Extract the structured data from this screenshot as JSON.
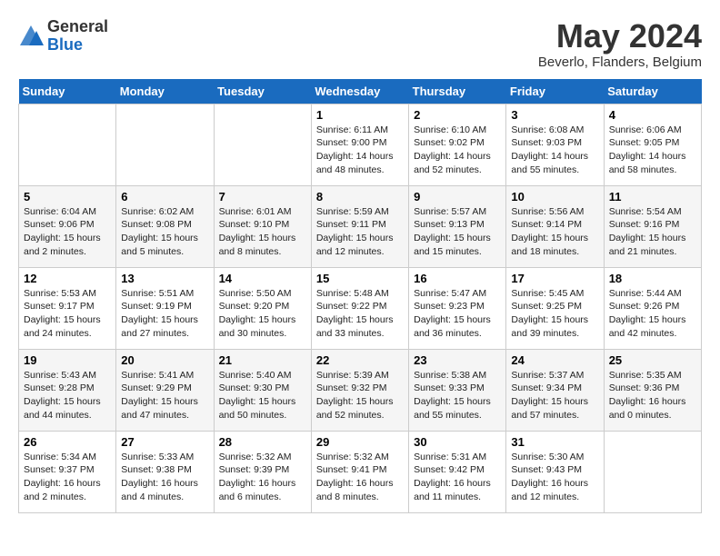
{
  "logo": {
    "general": "General",
    "blue": "Blue"
  },
  "title": "May 2024",
  "subtitle": "Beverlo, Flanders, Belgium",
  "days_of_week": [
    "Sunday",
    "Monday",
    "Tuesday",
    "Wednesday",
    "Thursday",
    "Friday",
    "Saturday"
  ],
  "weeks": [
    [
      {
        "day": "",
        "info": ""
      },
      {
        "day": "",
        "info": ""
      },
      {
        "day": "",
        "info": ""
      },
      {
        "day": "1",
        "info": "Sunrise: 6:11 AM\nSunset: 9:00 PM\nDaylight: 14 hours\nand 48 minutes."
      },
      {
        "day": "2",
        "info": "Sunrise: 6:10 AM\nSunset: 9:02 PM\nDaylight: 14 hours\nand 52 minutes."
      },
      {
        "day": "3",
        "info": "Sunrise: 6:08 AM\nSunset: 9:03 PM\nDaylight: 14 hours\nand 55 minutes."
      },
      {
        "day": "4",
        "info": "Sunrise: 6:06 AM\nSunset: 9:05 PM\nDaylight: 14 hours\nand 58 minutes."
      }
    ],
    [
      {
        "day": "5",
        "info": "Sunrise: 6:04 AM\nSunset: 9:06 PM\nDaylight: 15 hours\nand 2 minutes."
      },
      {
        "day": "6",
        "info": "Sunrise: 6:02 AM\nSunset: 9:08 PM\nDaylight: 15 hours\nand 5 minutes."
      },
      {
        "day": "7",
        "info": "Sunrise: 6:01 AM\nSunset: 9:10 PM\nDaylight: 15 hours\nand 8 minutes."
      },
      {
        "day": "8",
        "info": "Sunrise: 5:59 AM\nSunset: 9:11 PM\nDaylight: 15 hours\nand 12 minutes."
      },
      {
        "day": "9",
        "info": "Sunrise: 5:57 AM\nSunset: 9:13 PM\nDaylight: 15 hours\nand 15 minutes."
      },
      {
        "day": "10",
        "info": "Sunrise: 5:56 AM\nSunset: 9:14 PM\nDaylight: 15 hours\nand 18 minutes."
      },
      {
        "day": "11",
        "info": "Sunrise: 5:54 AM\nSunset: 9:16 PM\nDaylight: 15 hours\nand 21 minutes."
      }
    ],
    [
      {
        "day": "12",
        "info": "Sunrise: 5:53 AM\nSunset: 9:17 PM\nDaylight: 15 hours\nand 24 minutes."
      },
      {
        "day": "13",
        "info": "Sunrise: 5:51 AM\nSunset: 9:19 PM\nDaylight: 15 hours\nand 27 minutes."
      },
      {
        "day": "14",
        "info": "Sunrise: 5:50 AM\nSunset: 9:20 PM\nDaylight: 15 hours\nand 30 minutes."
      },
      {
        "day": "15",
        "info": "Sunrise: 5:48 AM\nSunset: 9:22 PM\nDaylight: 15 hours\nand 33 minutes."
      },
      {
        "day": "16",
        "info": "Sunrise: 5:47 AM\nSunset: 9:23 PM\nDaylight: 15 hours\nand 36 minutes."
      },
      {
        "day": "17",
        "info": "Sunrise: 5:45 AM\nSunset: 9:25 PM\nDaylight: 15 hours\nand 39 minutes."
      },
      {
        "day": "18",
        "info": "Sunrise: 5:44 AM\nSunset: 9:26 PM\nDaylight: 15 hours\nand 42 minutes."
      }
    ],
    [
      {
        "day": "19",
        "info": "Sunrise: 5:43 AM\nSunset: 9:28 PM\nDaylight: 15 hours\nand 44 minutes."
      },
      {
        "day": "20",
        "info": "Sunrise: 5:41 AM\nSunset: 9:29 PM\nDaylight: 15 hours\nand 47 minutes."
      },
      {
        "day": "21",
        "info": "Sunrise: 5:40 AM\nSunset: 9:30 PM\nDaylight: 15 hours\nand 50 minutes."
      },
      {
        "day": "22",
        "info": "Sunrise: 5:39 AM\nSunset: 9:32 PM\nDaylight: 15 hours\nand 52 minutes."
      },
      {
        "day": "23",
        "info": "Sunrise: 5:38 AM\nSunset: 9:33 PM\nDaylight: 15 hours\nand 55 minutes."
      },
      {
        "day": "24",
        "info": "Sunrise: 5:37 AM\nSunset: 9:34 PM\nDaylight: 15 hours\nand 57 minutes."
      },
      {
        "day": "25",
        "info": "Sunrise: 5:35 AM\nSunset: 9:36 PM\nDaylight: 16 hours\nand 0 minutes."
      }
    ],
    [
      {
        "day": "26",
        "info": "Sunrise: 5:34 AM\nSunset: 9:37 PM\nDaylight: 16 hours\nand 2 minutes."
      },
      {
        "day": "27",
        "info": "Sunrise: 5:33 AM\nSunset: 9:38 PM\nDaylight: 16 hours\nand 4 minutes."
      },
      {
        "day": "28",
        "info": "Sunrise: 5:32 AM\nSunset: 9:39 PM\nDaylight: 16 hours\nand 6 minutes."
      },
      {
        "day": "29",
        "info": "Sunrise: 5:32 AM\nSunset: 9:41 PM\nDaylight: 16 hours\nand 8 minutes."
      },
      {
        "day": "30",
        "info": "Sunrise: 5:31 AM\nSunset: 9:42 PM\nDaylight: 16 hours\nand 11 minutes."
      },
      {
        "day": "31",
        "info": "Sunrise: 5:30 AM\nSunset: 9:43 PM\nDaylight: 16 hours\nand 12 minutes."
      },
      {
        "day": "",
        "info": ""
      }
    ]
  ]
}
